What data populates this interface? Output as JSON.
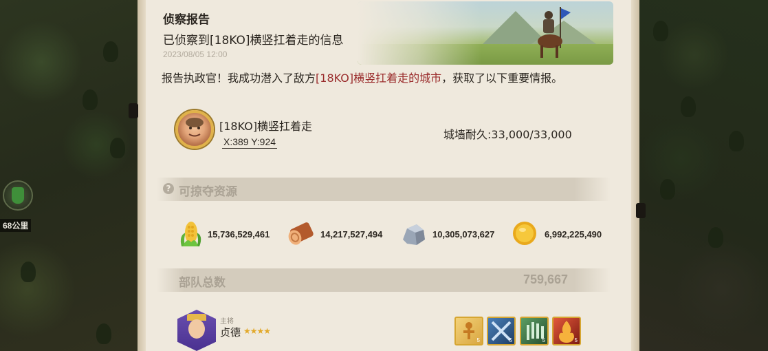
{
  "report": {
    "title": "侦察报告",
    "subtitle": "已侦察到[18KO]横竖扛着走的信息",
    "timestamp": "2023/08/05 12:00",
    "body_prefix": "报告执政官！我成功潜入了敌方",
    "body_enemy": "[18KO]横竖扛着走的城市",
    "body_suffix": "，获取了以下重要情报。"
  },
  "target": {
    "name": "[18KO]横竖扛着走",
    "coords": "X:389 Y:924",
    "wall_durability": "城墙耐久:33,000/33,000",
    "avatar_icon": "governor-portrait-icon"
  },
  "sections": {
    "lootable": "可掠夺资源",
    "help_icon": "?",
    "troops_label": "部队总数",
    "troops_total": "759,667"
  },
  "resources": [
    {
      "name": "food",
      "icon": "corn-icon",
      "value": "15,736,529,461"
    },
    {
      "name": "wood",
      "icon": "wood-log-icon",
      "value": "14,217,527,494"
    },
    {
      "name": "stone",
      "icon": "stone-icon",
      "value": "10,305,073,627"
    },
    {
      "name": "gold",
      "icon": "gold-coin-icon",
      "value": "6,992,225,490"
    }
  ],
  "commander": {
    "role": "主将",
    "name": "贞德",
    "stars": "★★★★",
    "skills": [
      {
        "icon": "ankh-skill-icon",
        "level": "5",
        "color": "#d9a640"
      },
      {
        "icon": "crossed-blades-skill-icon",
        "level": "5",
        "color": "#2f5c8f"
      },
      {
        "icon": "flag-hand-skill-icon",
        "level": "5",
        "color": "#3d7a4a"
      },
      {
        "icon": "fire-warrior-skill-icon",
        "level": "5",
        "color": "#b5311f"
      }
    ]
  },
  "map": {
    "distance": "68公里"
  }
}
